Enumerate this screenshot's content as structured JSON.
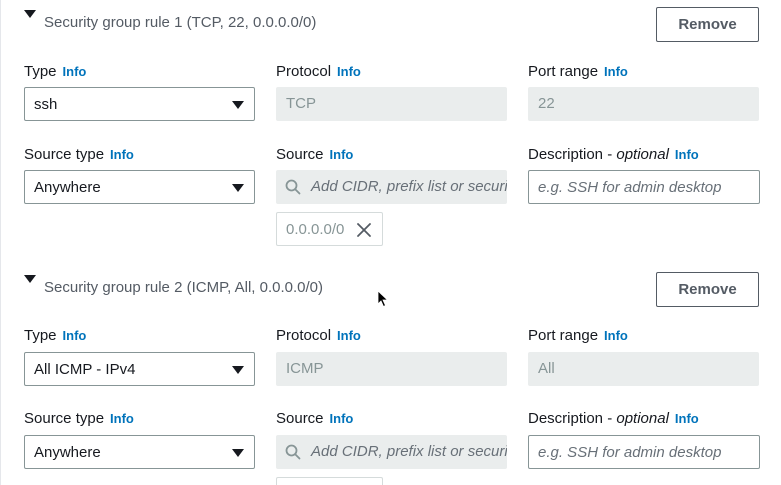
{
  "info_label": "Info",
  "rules": [
    {
      "title": "Security group rule 1 (TCP, 22, 0.0.0.0/0)",
      "remove_label": "Remove",
      "type_label": "Type",
      "type_value": "ssh",
      "protocol_label": "Protocol",
      "protocol_value": "TCP",
      "port_range_label": "Port range",
      "port_range_value": "22",
      "source_type_label": "Source type",
      "source_type_value": "Anywhere",
      "source_label": "Source",
      "source_placeholder": "Add CIDR, prefix list or security group",
      "source_token": "0.0.0.0/0",
      "description_label": "Description - ",
      "description_optional": "optional",
      "description_placeholder": "e.g. SSH for admin desktop"
    },
    {
      "title": "Security group rule 2 (ICMP, All, 0.0.0.0/0)",
      "remove_label": "Remove",
      "type_label": "Type",
      "type_value": "All ICMP - IPv4",
      "protocol_label": "Protocol",
      "protocol_value": "ICMP",
      "port_range_label": "Port range",
      "port_range_value": "All",
      "source_type_label": "Source type",
      "source_type_value": "Anywhere",
      "source_label": "Source",
      "source_placeholder": "Add CIDR, prefix list or security group",
      "description_label": "Description - ",
      "description_optional": "optional",
      "description_placeholder": "e.g. SSH for admin desktop"
    }
  ],
  "icons": {
    "caret": "caret-down-icon",
    "dropdown": "chevron-down-icon",
    "search": "search-icon",
    "remove_token": "close-icon",
    "cursor": "mouse-cursor-icon"
  },
  "colors": {
    "info_link": "#0073bb",
    "text": "#16191f",
    "muted": "#545b64",
    "disabled_bg": "#eaeded",
    "border": "#879596"
  }
}
